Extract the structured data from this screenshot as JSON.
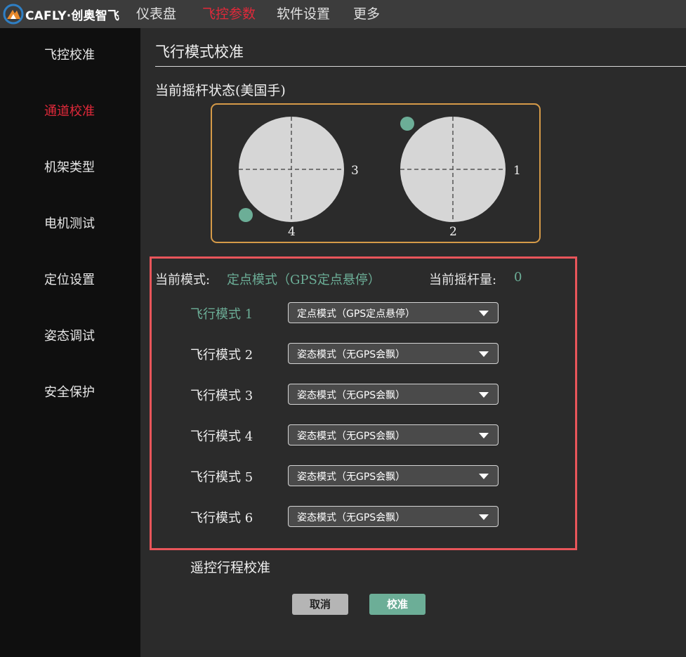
{
  "app": {
    "brand": "CAFLY·创奥智飞"
  },
  "nav": {
    "items": [
      {
        "label": "仪表盘",
        "active": false
      },
      {
        "label": "飞控参数",
        "active": true
      },
      {
        "label": "软件设置",
        "active": false
      },
      {
        "label": "更多",
        "active": false
      }
    ]
  },
  "sidebar": {
    "items": [
      {
        "label": "飞控校准",
        "active": false
      },
      {
        "label": "通道校准",
        "active": true
      },
      {
        "label": "机架类型",
        "active": false
      },
      {
        "label": "电机测试",
        "active": false
      },
      {
        "label": "定位设置",
        "active": false
      },
      {
        "label": "姿态调试",
        "active": false
      },
      {
        "label": "安全保护",
        "active": false
      }
    ]
  },
  "main": {
    "title": "飞行模式校准",
    "stick_status_title": "当前摇杆状态(美国手)",
    "left_stick": {
      "right_label": "3",
      "bottom_label": "4"
    },
    "right_stick": {
      "right_label": "1",
      "bottom_label": "2"
    },
    "current_mode_label": "当前模式:",
    "current_mode_value": "定点模式（GPS定点悬停）",
    "stick_amount_label": "当前摇杆量:",
    "stick_amount_value": "0",
    "flight_modes": [
      {
        "label": "飞行模式 1",
        "value": "定点模式（GPS定点悬停）",
        "active": true
      },
      {
        "label": "飞行模式 2",
        "value": "姿态模式（无GPS会飘）",
        "active": false
      },
      {
        "label": "飞行模式 3",
        "value": "姿态模式（无GPS会飘）",
        "active": false
      },
      {
        "label": "飞行模式 4",
        "value": "姿态模式（无GPS会飘）",
        "active": false
      },
      {
        "label": "飞行模式 5",
        "value": "姿态模式（无GPS会飘）",
        "active": false
      },
      {
        "label": "飞行模式 6",
        "value": "姿态模式（无GPS会飘）",
        "active": false
      }
    ],
    "remote_title": "遥控行程校准",
    "cancel_label": "取消",
    "calibrate_label": "校准"
  },
  "colors": {
    "accent_red": "#e0293a",
    "accent_green": "#6cae97",
    "stick_border": "#d59a48",
    "highlight_box": "#e8555a"
  }
}
